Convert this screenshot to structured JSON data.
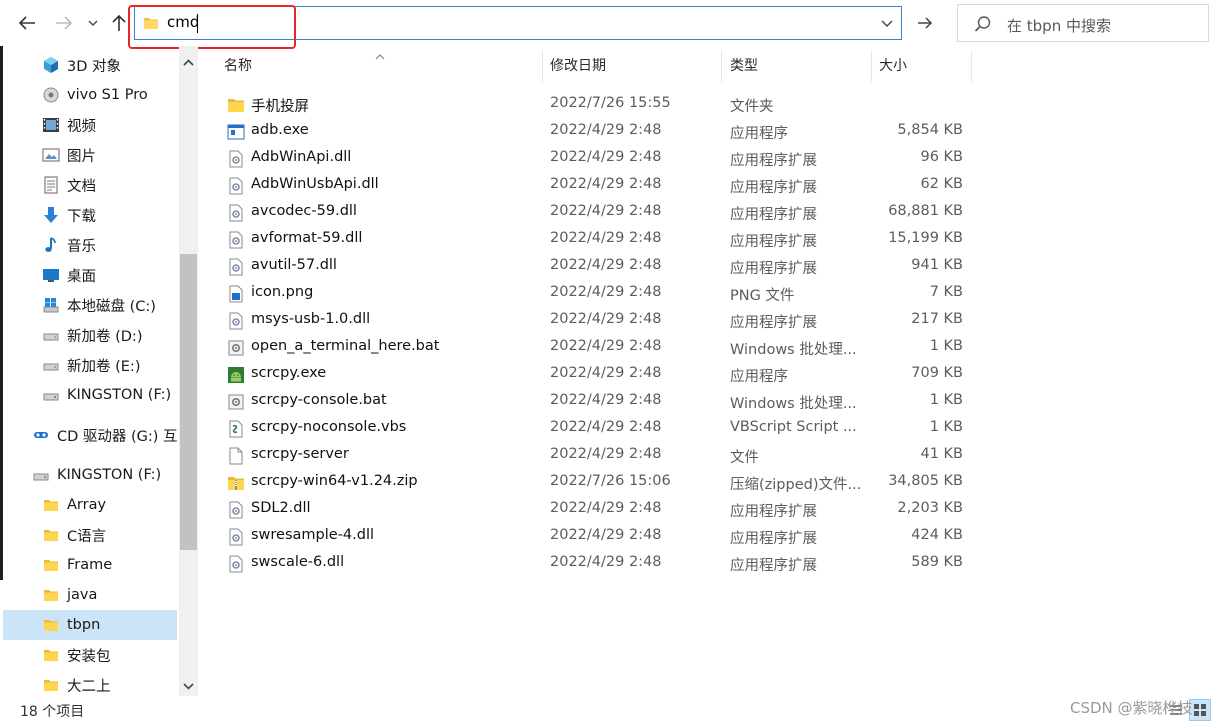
{
  "address": {
    "value": "cmd"
  },
  "search": {
    "placeholder": "在 tbpn 中搜索"
  },
  "nav": {
    "items": [
      {
        "label": "3D 对象",
        "icon": "cube-3d-icon"
      },
      {
        "label": "vivo S1 Pro",
        "icon": "phone-device-icon"
      },
      {
        "label": "视频",
        "icon": "video-icon"
      },
      {
        "label": "图片",
        "icon": "pictures-icon"
      },
      {
        "label": "文档",
        "icon": "documents-icon"
      },
      {
        "label": "下载",
        "icon": "download-arrow-icon"
      },
      {
        "label": "音乐",
        "icon": "music-note-icon"
      },
      {
        "label": "桌面",
        "icon": "desktop-icon"
      },
      {
        "label": "本地磁盘 (C:)",
        "icon": "windows-drive-icon"
      },
      {
        "label": "新加卷 (D:)",
        "icon": "drive-icon"
      },
      {
        "label": "新加卷 (E:)",
        "icon": "drive-icon"
      },
      {
        "label": "KINGSTON (F:)",
        "icon": "usb-drive-icon"
      },
      {
        "label": "CD 驱动器 (G:) 互",
        "icon": "cd-drive-icon"
      },
      {
        "label": "KINGSTON (F:)",
        "icon": "usb-drive-icon"
      },
      {
        "label": "Array",
        "icon": "folder-icon"
      },
      {
        "label": "C语言",
        "icon": "folder-icon"
      },
      {
        "label": "Frame",
        "icon": "folder-icon"
      },
      {
        "label": "java",
        "icon": "folder-icon"
      },
      {
        "label": "tbpn",
        "icon": "folder-icon"
      },
      {
        "label": "安装包",
        "icon": "folder-icon"
      },
      {
        "label": "大二上",
        "icon": "folder-icon"
      }
    ]
  },
  "columns": {
    "name": "名称",
    "date": "修改日期",
    "type": "类型",
    "size": "大小"
  },
  "files": [
    {
      "name": "手机投屏",
      "date": "2022/7/26 15:55",
      "type": "文件夹",
      "size": "",
      "icon": "folder-icon"
    },
    {
      "name": "adb.exe",
      "date": "2022/4/29 2:48",
      "type": "应用程序",
      "size": "5,854 KB",
      "icon": "exe-window-icon"
    },
    {
      "name": "AdbWinApi.dll",
      "date": "2022/4/29 2:48",
      "type": "应用程序扩展",
      "size": "96 KB",
      "icon": "dll-gear-icon"
    },
    {
      "name": "AdbWinUsbApi.dll",
      "date": "2022/4/29 2:48",
      "type": "应用程序扩展",
      "size": "62 KB",
      "icon": "dll-gear-icon"
    },
    {
      "name": "avcodec-59.dll",
      "date": "2022/4/29 2:48",
      "type": "应用程序扩展",
      "size": "68,881 KB",
      "icon": "dll-gear-icon"
    },
    {
      "name": "avformat-59.dll",
      "date": "2022/4/29 2:48",
      "type": "应用程序扩展",
      "size": "15,199 KB",
      "icon": "dll-gear-icon"
    },
    {
      "name": "avutil-57.dll",
      "date": "2022/4/29 2:48",
      "type": "应用程序扩展",
      "size": "941 KB",
      "icon": "dll-gear-icon"
    },
    {
      "name": "icon.png",
      "date": "2022/4/29 2:48",
      "type": "PNG 文件",
      "size": "7 KB",
      "icon": "png-image-icon"
    },
    {
      "name": "msys-usb-1.0.dll",
      "date": "2022/4/29 2:48",
      "type": "应用程序扩展",
      "size": "217 KB",
      "icon": "dll-gear-icon"
    },
    {
      "name": "open_a_terminal_here.bat",
      "date": "2022/4/29 2:48",
      "type": "Windows 批处理...",
      "size": "1 KB",
      "icon": "bat-gear-icon"
    },
    {
      "name": "scrcpy.exe",
      "date": "2022/4/29 2:48",
      "type": "应用程序",
      "size": "709 KB",
      "icon": "android-robot-icon"
    },
    {
      "name": "scrcpy-console.bat",
      "date": "2022/4/29 2:48",
      "type": "Windows 批处理...",
      "size": "1 KB",
      "icon": "bat-gear-icon"
    },
    {
      "name": "scrcpy-noconsole.vbs",
      "date": "2022/4/29 2:48",
      "type": "VBScript Script ...",
      "size": "1 KB",
      "icon": "vbs-script-icon"
    },
    {
      "name": "scrcpy-server",
      "date": "2022/4/29 2:48",
      "type": "文件",
      "size": "41 KB",
      "icon": "blank-file-icon"
    },
    {
      "name": "scrcpy-win64-v1.24.zip",
      "date": "2022/7/26 15:06",
      "type": "压缩(zipped)文件...",
      "size": "34,805 KB",
      "icon": "zip-folder-icon"
    },
    {
      "name": "SDL2.dll",
      "date": "2022/4/29 2:48",
      "type": "应用程序扩展",
      "size": "2,203 KB",
      "icon": "dll-gear-icon"
    },
    {
      "name": "swresample-4.dll",
      "date": "2022/4/29 2:48",
      "type": "应用程序扩展",
      "size": "424 KB",
      "icon": "dll-gear-icon"
    },
    {
      "name": "swscale-6.dll",
      "date": "2022/4/29 2:48",
      "type": "应用程序扩展",
      "size": "589 KB",
      "icon": "dll-gear-icon"
    }
  ],
  "status": {
    "count": "18 个项目"
  },
  "watermark": "CSDN @紫晓桦技"
}
